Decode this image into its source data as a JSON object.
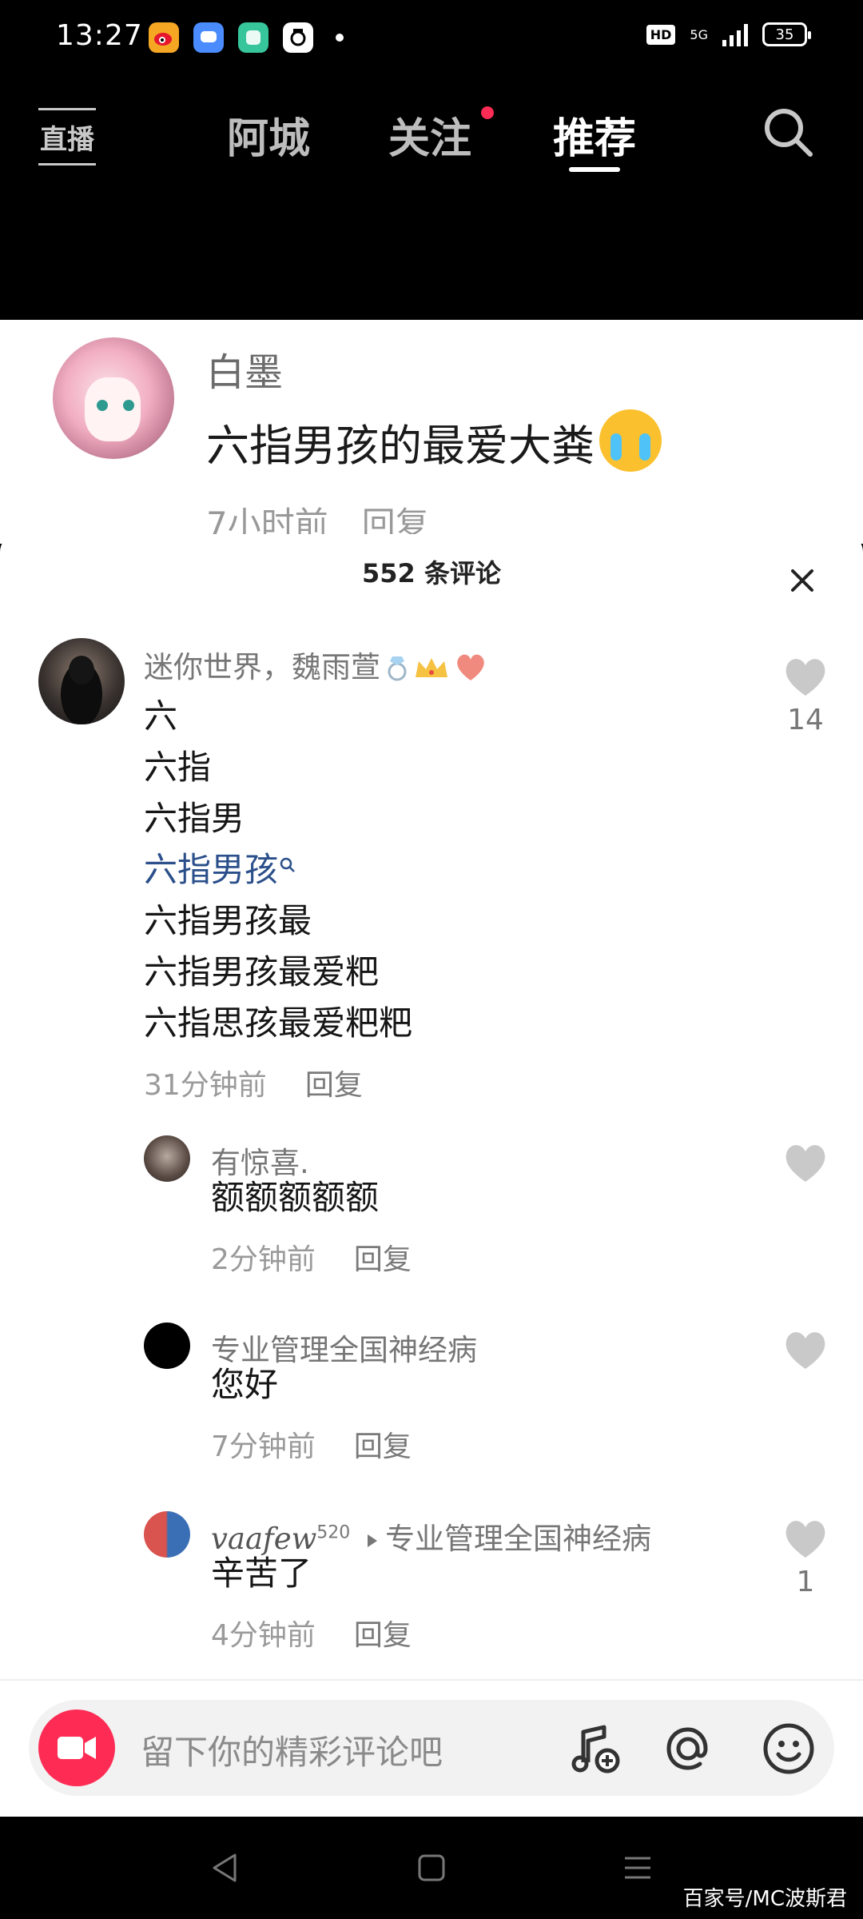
{
  "status_bar": {
    "time": "13:27",
    "hd": "HD",
    "network": "5G",
    "battery": "35"
  },
  "top_nav": {
    "live_label": "直播",
    "tabs": [
      {
        "label": "阿城",
        "active": false
      },
      {
        "label": "关注",
        "active": false,
        "has_dot": true
      },
      {
        "label": "推荐",
        "active": true
      }
    ]
  },
  "video": {
    "username": "白墨",
    "caption": "六指男孩的最爱大粪",
    "meta": "7小时前　回复"
  },
  "sheet": {
    "title": "552 条评论"
  },
  "comments": [
    {
      "username": "迷你世界，魏雨萱",
      "lines": [
        "六",
        "六指",
        "六指男",
        "六指男孩",
        "六指男孩最",
        "六指男孩最爱粑",
        "六指思孩最爱粑粑"
      ],
      "link_line_index": 3,
      "time": "31分钟前",
      "reply_label": "回复",
      "likes": "14"
    },
    {
      "username": "有惊喜.",
      "text": "额额额额额",
      "time": "2分钟前",
      "reply_label": "回复",
      "likes": ""
    },
    {
      "username": "专业管理全国神经病",
      "text": "您好",
      "time": "7分钟前",
      "reply_label": "回复",
      "likes": ""
    },
    {
      "username": "vaafew",
      "user_superscript": "520",
      "reply_to": "专业管理全国神经病",
      "text": "辛苦了",
      "time": "4分钟前",
      "reply_label": "回复",
      "likes": "1"
    }
  ],
  "input": {
    "placeholder": "留下你的精彩评论吧"
  },
  "watermark": "百家号/MC波斯君",
  "colors": {
    "accent_red": "#fe2c55",
    "link_blue": "#2a4f8a"
  }
}
